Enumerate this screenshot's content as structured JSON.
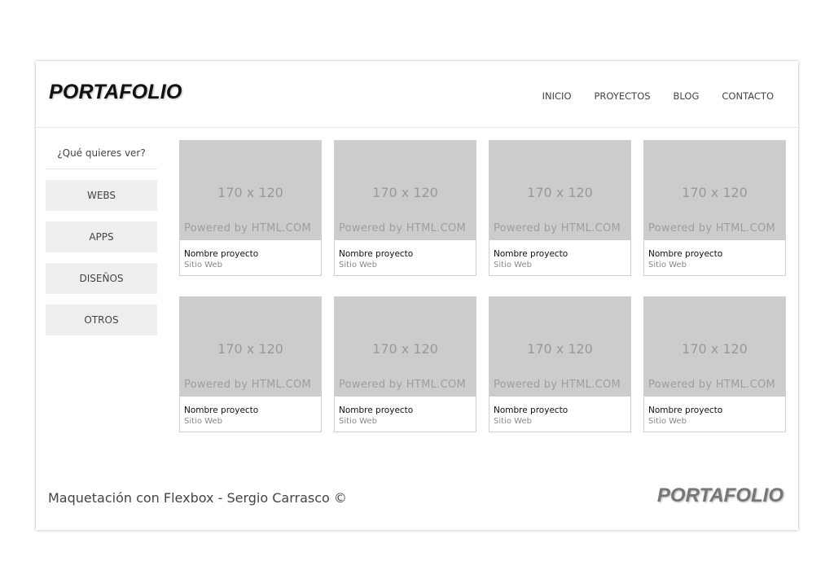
{
  "header": {
    "logo": "PORTAFOLIO",
    "nav": [
      "INICIO",
      "PROYECTOS",
      "BLOG",
      "CONTACTO"
    ]
  },
  "sidebar": {
    "title": "¿Qué quieres ver?",
    "filters": [
      "WEBS",
      "APPS",
      "DISEÑOS",
      "OTROS"
    ]
  },
  "projects": [
    {
      "thumb_size": "170 x 120",
      "thumb_caption": "Powered by HTML.COM",
      "name": "Nombre proyecto",
      "type": "Sitio Web"
    },
    {
      "thumb_size": "170 x 120",
      "thumb_caption": "Powered by HTML.COM",
      "name": "Nombre proyecto",
      "type": "Sitio Web"
    },
    {
      "thumb_size": "170 x 120",
      "thumb_caption": "Powered by HTML.COM",
      "name": "Nombre proyecto",
      "type": "Sitio Web"
    },
    {
      "thumb_size": "170 x 120",
      "thumb_caption": "Powered by HTML.COM",
      "name": "Nombre proyecto",
      "type": "Sitio Web"
    },
    {
      "thumb_size": "170 x 120",
      "thumb_caption": "Powered by HTML.COM",
      "name": "Nombre proyecto",
      "type": "Sitio Web"
    },
    {
      "thumb_size": "170 x 120",
      "thumb_caption": "Powered by HTML.COM",
      "name": "Nombre proyecto",
      "type": "Sitio Web"
    },
    {
      "thumb_size": "170 x 120",
      "thumb_caption": "Powered by HTML.COM",
      "name": "Nombre proyecto",
      "type": "Sitio Web"
    },
    {
      "thumb_size": "170 x 120",
      "thumb_caption": "Powered by HTML.COM",
      "name": "Nombre proyecto",
      "type": "Sitio Web"
    }
  ],
  "footer": {
    "credits": "Maquetación con Flexbox - Sergio Carrasco ©",
    "logo": "PORTAFOLIO"
  }
}
